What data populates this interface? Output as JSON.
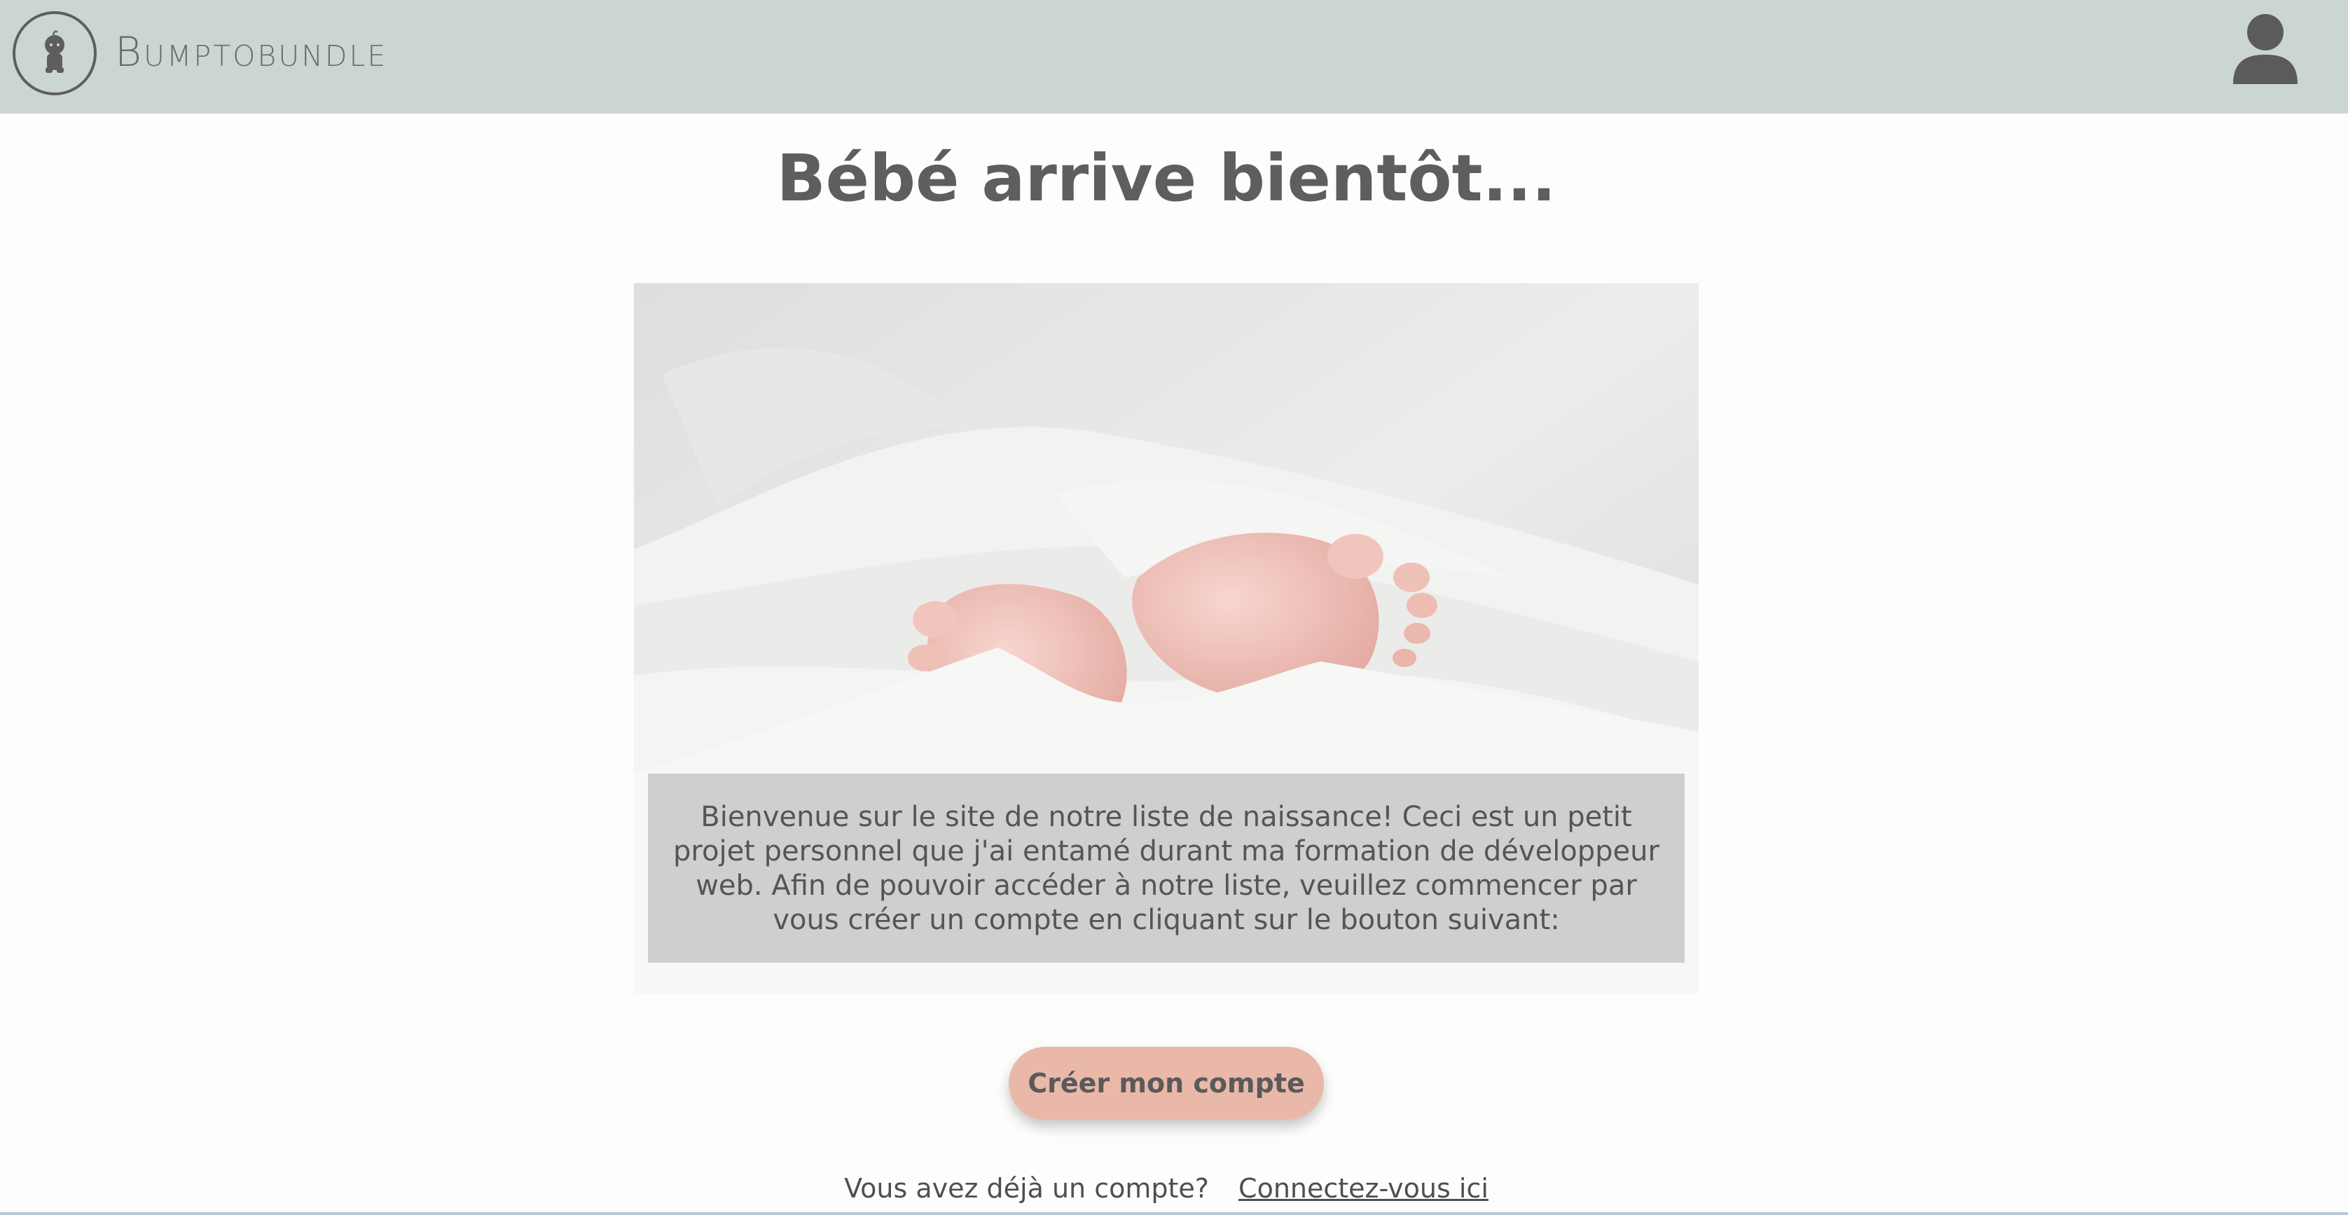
{
  "header": {
    "brand": "Bumptobundle",
    "logo_icon": "baby-icon",
    "account_icon": "user-icon"
  },
  "main": {
    "title": "Bébé arrive bientôt...",
    "hero_image": "baby-feet-under-white-towel",
    "intro_text": "Bienvenue sur le site de notre liste de naissance! Ceci est un petit projet personnel que j'ai entamé durant ma formation de développeur web. Afin de pouvoir accéder à notre liste, veuillez commencer par vous créer un compte en cliquant sur le bouton suivant:",
    "cta_label": "Créer mon compte",
    "login_prompt": "Vous avez déjà un compte?",
    "login_link": "Connectez-vous ici"
  },
  "colors": {
    "header_bg": "#cbd6d2",
    "page_bg": "#fdfdfb",
    "text": "#5e5e5e",
    "cta_bg": "#e9b8a8"
  }
}
